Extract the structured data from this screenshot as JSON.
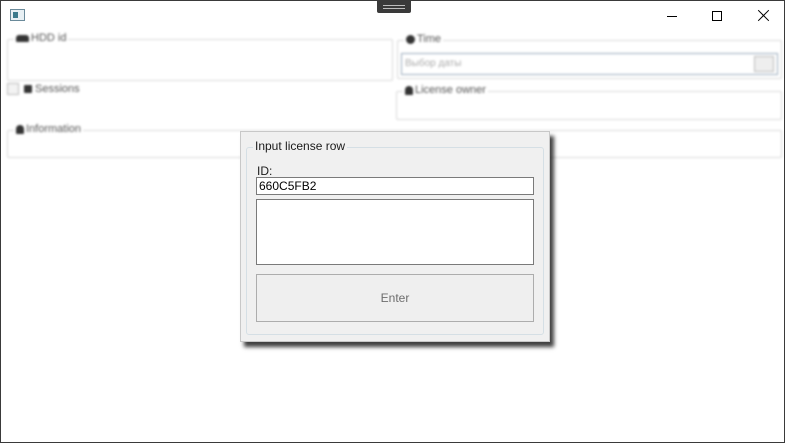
{
  "window": {
    "min_icon": "minimize-icon",
    "max_icon": "maximize-icon",
    "close_icon": "close-icon",
    "app_icon": "app-icon"
  },
  "background": {
    "hdd_label": "HDD id",
    "time_label": "Time",
    "date_placeholder": "Выбор даты",
    "license_owner_label": "License owner",
    "sessions_label": "Sessions",
    "information_label": "Information"
  },
  "dialog": {
    "title": "Input license row",
    "id_label": "ID:",
    "id_value": "660C5FB2",
    "text_value": "",
    "enter_label": "Enter"
  }
}
